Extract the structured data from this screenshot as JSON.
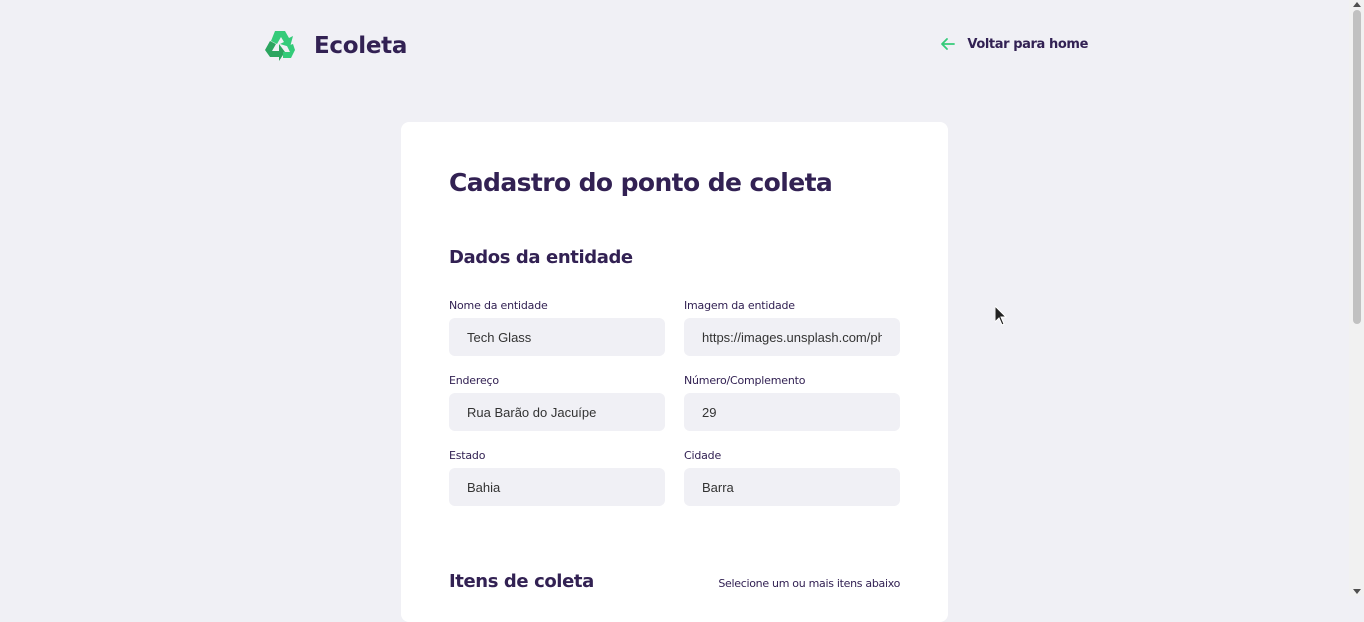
{
  "header": {
    "logo_text": "Ecoleta",
    "logo_icon": "recycle-icon",
    "back_label": "Voltar para home",
    "back_icon": "arrow-left-icon"
  },
  "form": {
    "title": "Cadastro do ponto de coleta",
    "entity_section": "Dados da entidade",
    "fields": {
      "name": {
        "label": "Nome da entidade",
        "value": "Tech Glass"
      },
      "image": {
        "label": "Imagem da entidade",
        "value": "https://images.unsplash.com/photo"
      },
      "address": {
        "label": "Endereço",
        "value": "Rua Barão do Jacuípe"
      },
      "number": {
        "label": "Número/Complemento",
        "value": "29"
      },
      "state": {
        "label": "Estado",
        "value": "Bahia"
      },
      "city": {
        "label": "Cidade",
        "value": "Barra"
      }
    },
    "items_section": "Itens de coleta",
    "items_hint": "Selecione um ou mais itens abaixo"
  },
  "colors": {
    "primary": "#34cb79",
    "title": "#322153",
    "background": "#f0f0f5",
    "card": "#ffffff"
  }
}
